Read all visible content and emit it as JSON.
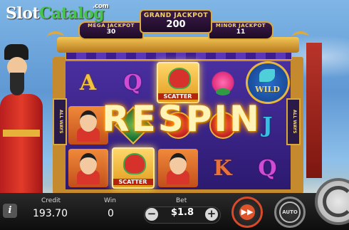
{
  "logo": {
    "slot": "Slot",
    "catalog": "Catalog",
    "com": ".com"
  },
  "jackpots": {
    "grand": {
      "label": "GRAND JACKPOT",
      "value": "200"
    },
    "mega": {
      "label": "MEGA JACKPOT",
      "value": "30"
    },
    "minor": {
      "label": "MINOR JACKPOT",
      "value": "11"
    }
  },
  "side_labels": {
    "left": "ALL WAYS",
    "right": "ALL WAYS"
  },
  "reels": [
    [
      "A",
      "kid",
      "kid"
    ],
    [
      "Q",
      "green-gem",
      "scatter"
    ],
    [
      "scatter",
      "red-gem",
      "kid"
    ],
    [
      "flower",
      "red-gem",
      "K"
    ],
    [
      "wild",
      "J",
      "Q"
    ]
  ],
  "scatter_label": "SCATTER",
  "wild_label": "WILD",
  "banner": "RESPIN",
  "bottom": {
    "info_label": "i",
    "credit_label": "Credit",
    "credit_value": "193.70",
    "win_label": "Win",
    "win_value": "0",
    "bet_label": "Bet",
    "bet_value": "$1.8",
    "minus": "−",
    "plus": "+",
    "fast_label": "▶▶",
    "auto_label": "AUTO"
  },
  "colors": {
    "accent": "#d9a93d",
    "reel_bg": "#3a2588",
    "bar_bg": "#1a1a1a",
    "spin_border": "#d94a2a"
  }
}
